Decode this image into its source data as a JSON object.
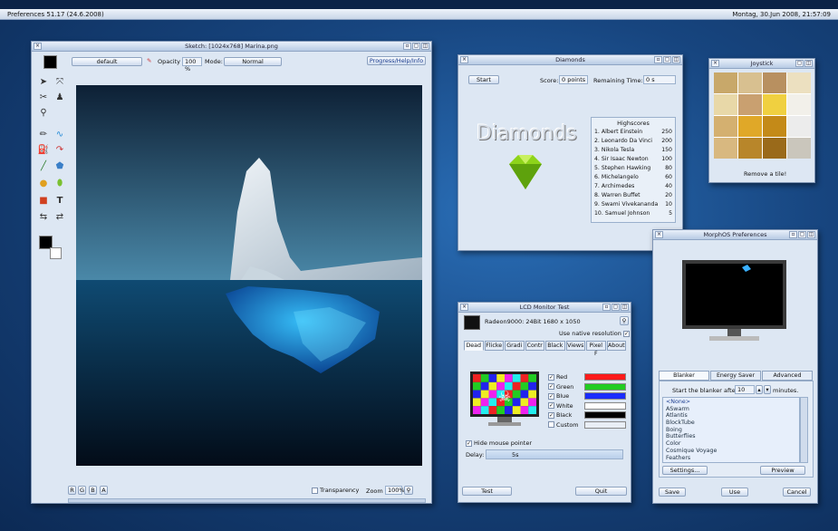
{
  "menubar": {
    "left": "Preferences 51.17 (24.6.2008)",
    "right": "Montag, 30.Jun 2008, 21:57:09"
  },
  "sketch": {
    "title": "Sketch: [1024x768] Marina.png",
    "brush": "default",
    "opacity_label": "Opacity",
    "opacity": "100 %",
    "mode_label": "Mode:",
    "mode": "Normal",
    "help": "Progress/Help/Info",
    "channels": [
      "R",
      "G",
      "B",
      "A"
    ],
    "transparency": "Transparency",
    "zoom_label": "Zoom",
    "zoom": "100%"
  },
  "diamonds": {
    "title": "Diamonds",
    "start": "Start",
    "score_label": "Score:",
    "score": "0 points",
    "remaining_label": "Remaining Time:",
    "remaining": "0 s",
    "logo": "Diamonds",
    "highscores_title": "Highscores",
    "highscores": [
      {
        "rank": "1.",
        "name": "Albert Einstein",
        "score": "250"
      },
      {
        "rank": "2.",
        "name": "Leonardo Da Vinci",
        "score": "200"
      },
      {
        "rank": "3.",
        "name": "Nikola Tesla",
        "score": "150"
      },
      {
        "rank": "4.",
        "name": "Sir Isaac Newton",
        "score": "100"
      },
      {
        "rank": "5.",
        "name": "Stephen Hawking",
        "score": "80"
      },
      {
        "rank": "6.",
        "name": "Michelangelo",
        "score": "60"
      },
      {
        "rank": "7.",
        "name": "Archimedes",
        "score": "40"
      },
      {
        "rank": "8.",
        "name": "Warren Buffet",
        "score": "20"
      },
      {
        "rank": "9.",
        "name": "Swami Vivekananda",
        "score": "10"
      },
      {
        "rank": "10.",
        "name": "Samuel Johnson",
        "score": "5"
      }
    ]
  },
  "joystick": {
    "title": "Joystick",
    "caption": "Remove a tile!"
  },
  "lcd": {
    "title": "LCD Monitor Test",
    "device": "Radeon9000: 24Bit 1680 x 1050",
    "native": "Use native resolution",
    "tabs": [
      "Dead",
      "Flicke",
      "Gradi",
      "Contr",
      "Black",
      "Views",
      "Pixel F",
      "About"
    ],
    "colors": [
      {
        "label": "Red",
        "hex": "#ff1a1a"
      },
      {
        "label": "Green",
        "hex": "#22cc22"
      },
      {
        "label": "Blue",
        "hex": "#1a2cff"
      },
      {
        "label": "White",
        "hex": "#ffffff"
      },
      {
        "label": "Black",
        "hex": "#000000"
      },
      {
        "label": "Custom",
        "hex": "#e9eef5"
      }
    ],
    "hide_pointer": "Hide mouse pointer",
    "delay_label": "Delay:",
    "delay": "5s",
    "test": "Test",
    "quit": "Quit"
  },
  "prefs": {
    "title": "MorphOS Preferences",
    "tabs": [
      "Blanker",
      "Energy Saver",
      "Advanced"
    ],
    "start_label": "Start the blanker after",
    "minutes": "10",
    "minutes_label": "minutes.",
    "blankers": [
      "<None>",
      "ASwarm",
      "Atlantis",
      "BlockTube",
      "Boing",
      "Butterflies",
      "Color",
      "Cosmique Voyage",
      "Feathers"
    ],
    "settings": "Settings...",
    "preview": "Preview",
    "save": "Save",
    "use": "Use",
    "cancel": "Cancel"
  }
}
